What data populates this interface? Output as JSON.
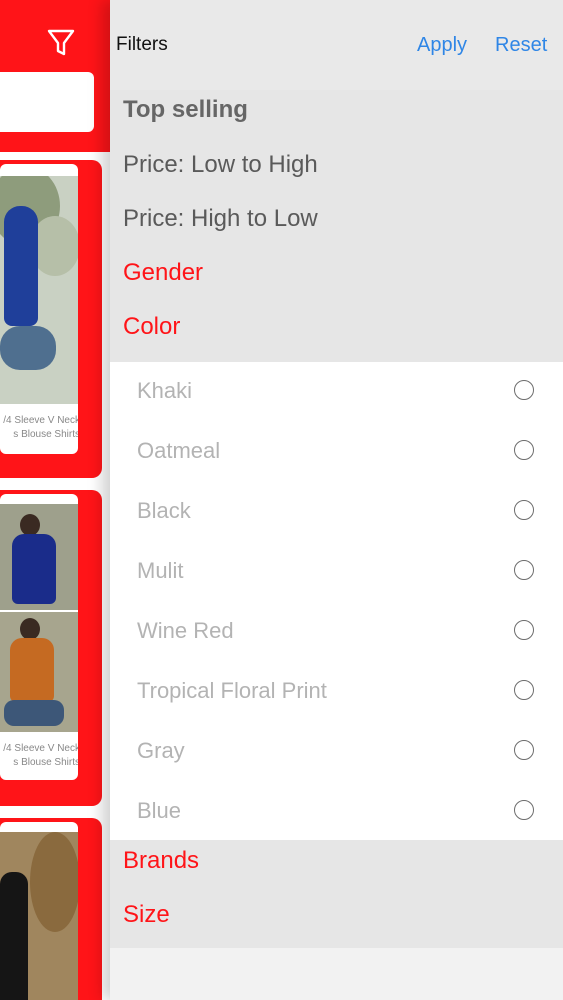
{
  "background_list": {
    "cards": [
      {
        "caption_line1": "/4 Sleeve V Neck",
        "caption_line2": "s Blouse Shirts"
      },
      {
        "caption_line1": "/4 Sleeve V Neck",
        "caption_line2": "s Blouse Shirts"
      }
    ]
  },
  "filters": {
    "title": "Filters",
    "apply_label": "Apply",
    "reset_label": "Reset",
    "sort_options": [
      "Top selling",
      "Price: Low to High",
      "Price: High to Low"
    ],
    "categories": {
      "gender": "Gender",
      "color": "Color",
      "brands": "Brands",
      "size": "Size"
    },
    "colors": [
      {
        "label": "Khaki",
        "selected": false
      },
      {
        "label": "Oatmeal",
        "selected": false
      },
      {
        "label": "Black",
        "selected": false
      },
      {
        "label": "Mulit",
        "selected": false
      },
      {
        "label": "Wine Red",
        "selected": false
      },
      {
        "label": "Tropical Floral Print",
        "selected": false
      },
      {
        "label": "Gray",
        "selected": false
      },
      {
        "label": "Blue",
        "selected": false
      }
    ]
  },
  "colors": {
    "accent_red": "#ff1418",
    "link_blue": "#2f86e6"
  }
}
